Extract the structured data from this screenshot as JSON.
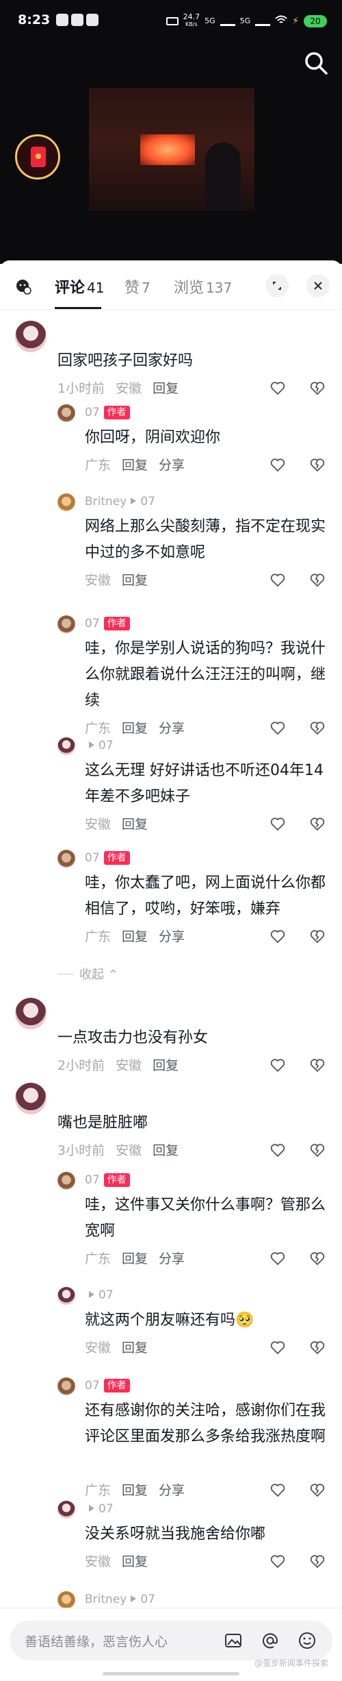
{
  "status_bar": {
    "time": "8:23",
    "net_speed": "24.7",
    "net_unit": "KB/s",
    "sig1": "5G",
    "sig2": "5G",
    "battery": "20"
  },
  "tabs": [
    {
      "label": "评论",
      "count": "41"
    },
    {
      "label": "赞",
      "count": "7"
    },
    {
      "label": "浏览",
      "count": "137"
    }
  ],
  "author_tag": "作者",
  "comments": [
    {
      "user": "",
      "text": "回家吧孩子回家好吗",
      "time": "1小时前",
      "loc": "安徽",
      "reply": "回复"
    },
    {
      "user": "07",
      "text": "你回呀，阴间欢迎你",
      "loc": "广东",
      "reply": "回复",
      "share": "分享"
    },
    {
      "user": "Britney",
      "to": "07",
      "text": "网络上那么尖酸刻薄，指不定在现实中过的多不如意呢",
      "loc": "安徽",
      "reply": "回复"
    },
    {
      "user": "07",
      "text": "哇，你是学别人说话的狗吗？我说什么你就跟着说什么汪汪汪的叫啊，继续",
      "loc": "广东",
      "reply": "回复",
      "share": "分享"
    },
    {
      "user": "",
      "to": "07",
      "text": "这么无理 好好讲话也不听还04年14年差不多吧妹子",
      "loc": "安徽",
      "reply": "回复"
    },
    {
      "user": "07",
      "text": "哇，你太蠢了吧，网上面说什么你都相信了，哎哟，好笨哦，嫌弃",
      "loc": "广东",
      "reply": "回复",
      "share": "分享"
    },
    {
      "collapse": "收起"
    },
    {
      "user": "",
      "text": "一点攻击力也没有孙女",
      "time": "2小时前",
      "loc": "安徽",
      "reply": "回复"
    },
    {
      "user": "",
      "text": "嘴也是脏脏嘟",
      "time": "3小时前",
      "loc": "安徽",
      "reply": "回复"
    },
    {
      "user": "07",
      "text": "哇，这件事又关你什么事啊？管那么宽啊",
      "loc": "广东",
      "reply": "回复",
      "share": "分享"
    },
    {
      "user": "",
      "to": "07",
      "text": "就这两个朋友嘛还有吗🥺",
      "loc": "安徽",
      "reply": "回复"
    },
    {
      "user": "07",
      "text": "还有感谢你的关注哈，感谢你们在我评论区里面发那么多条给我涨热度啊",
      "loc": "广东",
      "reply": "回复",
      "share": "分享"
    },
    {
      "user": "",
      "to": "07",
      "text": "没关系呀就当我施舍给你嘟",
      "loc": "安徽",
      "reply": "回复"
    },
    {
      "user": "Britney",
      "to": "07"
    }
  ],
  "input": {
    "placeholder": "善语结善缘，恶言伤人心"
  },
  "watermark": "@蛋步新闻事件探索"
}
